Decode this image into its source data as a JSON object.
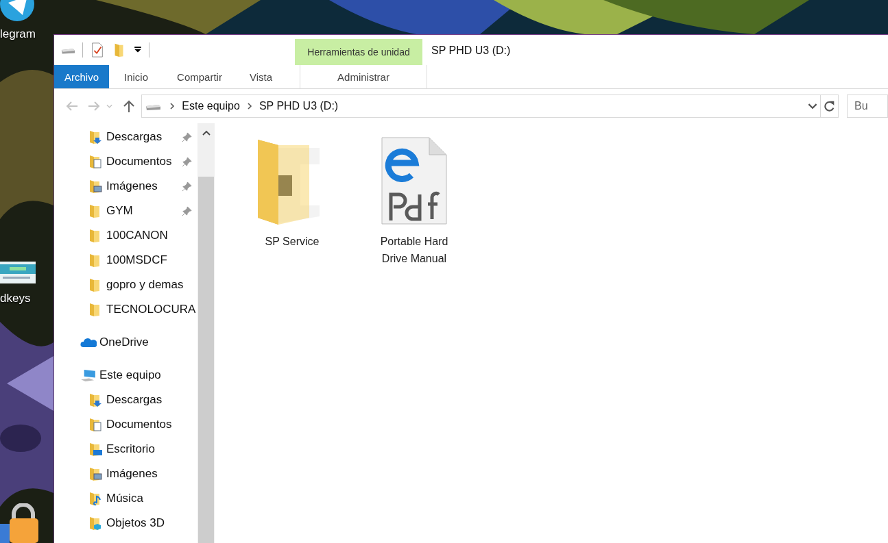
{
  "desktop": {
    "icons": [
      {
        "label": "legram",
        "kind": "telegram"
      },
      {
        "label": "dkeys",
        "kind": "thumbnail"
      },
      {
        "kind": "lock"
      }
    ]
  },
  "window": {
    "title": "SP PHD U3 (D:)",
    "context_tab": {
      "header": "Herramientas de unidad",
      "label": "Administrar",
      "selected": false
    },
    "ribbon_tabs": [
      {
        "label": "Archivo",
        "selected": true
      },
      {
        "label": "Inicio",
        "selected": false
      },
      {
        "label": "Compartir",
        "selected": false
      },
      {
        "label": "Vista",
        "selected": false
      }
    ],
    "address": {
      "segments": [
        "Este equipo",
        "SP PHD U3 (D:)"
      ]
    },
    "search": {
      "placeholder": "Bu"
    },
    "nav": {
      "quick_access": [
        {
          "label": "Descargas",
          "kind": "downloads",
          "pinned": true
        },
        {
          "label": "Documentos",
          "kind": "documents",
          "pinned": true
        },
        {
          "label": "Imágenes",
          "kind": "pictures",
          "pinned": true
        },
        {
          "label": "GYM",
          "kind": "folder",
          "pinned": true
        },
        {
          "label": "100CANON",
          "kind": "folder",
          "pinned": false
        },
        {
          "label": "100MSDCF",
          "kind": "folder",
          "pinned": false
        },
        {
          "label": "gopro y demas",
          "kind": "folder",
          "pinned": false
        },
        {
          "label": "TECNOLOCURA",
          "kind": "folder",
          "pinned": false
        }
      ],
      "onedrive": {
        "label": "OneDrive",
        "kind": "onedrive"
      },
      "this_pc": {
        "label": "Este equipo",
        "kind": "pc",
        "children": [
          {
            "label": "Descargas",
            "kind": "downloads"
          },
          {
            "label": "Documentos",
            "kind": "documents"
          },
          {
            "label": "Escritorio",
            "kind": "desktop"
          },
          {
            "label": "Imágenes",
            "kind": "pictures"
          },
          {
            "label": "Música",
            "kind": "music"
          },
          {
            "label": "Objetos 3D",
            "kind": "objects3d"
          }
        ]
      }
    },
    "files": [
      {
        "name": "SP Service",
        "kind": "folder"
      },
      {
        "name": "Portable Hard Drive Manual",
        "kind": "pdf"
      }
    ]
  }
}
